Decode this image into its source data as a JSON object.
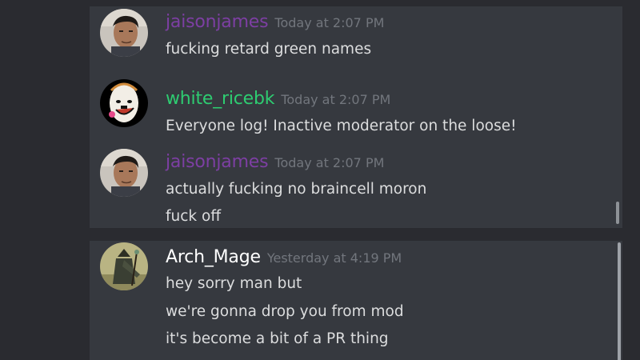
{
  "messages": [
    {
      "username": "jaisonjames",
      "username_color": "#7d3fa3",
      "timestamp": "Today at 2:07 PM",
      "lines": [
        "fucking retard green names"
      ]
    },
    {
      "username": "white_ricebk",
      "username_color": "#2ecc71",
      "timestamp": "Today at 2:07 PM",
      "lines": [
        "Everyone log! Inactive moderator on the loose!"
      ]
    },
    {
      "username": "jaisonjames",
      "username_color": "#7d3fa3",
      "timestamp": "Today at 2:07 PM",
      "lines": [
        "actually fucking no braincell moron",
        "fuck off"
      ]
    },
    {
      "username": "Arch_Mage",
      "username_color": "#ffffff",
      "timestamp": "Yesterday at 4:19 PM",
      "lines": [
        "hey sorry man but",
        "we're gonna drop you from mod",
        "it's become a bit of a PR thing"
      ]
    }
  ],
  "avatars": {
    "jaisonjames": "person-photo-avatar",
    "white_ricebk": "cartoon-face-avatar",
    "Arch_Mage": "wizard-figure-avatar"
  }
}
